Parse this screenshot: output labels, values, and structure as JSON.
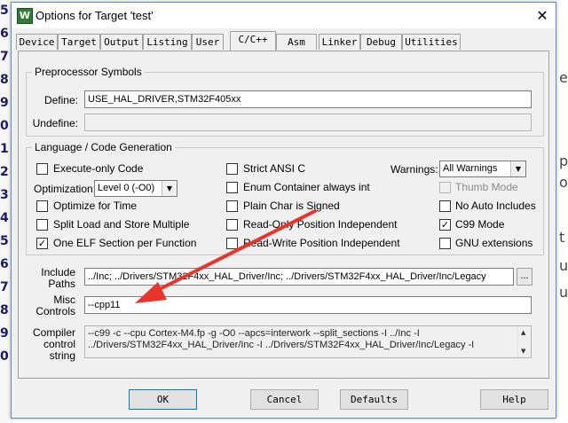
{
  "window": {
    "title": "Options for Target 'test'",
    "close_glyph": "✕",
    "app_icon_glyph": "W"
  },
  "tabs": [
    {
      "label": "Device"
    },
    {
      "label": "Target"
    },
    {
      "label": "Output"
    },
    {
      "label": "Listing"
    },
    {
      "label": "User"
    },
    {
      "label": "C/C++",
      "active": true
    },
    {
      "label": "Asm"
    },
    {
      "label": "Linker"
    },
    {
      "label": "Debug"
    },
    {
      "label": "Utilities"
    }
  ],
  "preprocessor": {
    "legend": "Preprocessor Symbols",
    "define_label": "Define:",
    "define_value": "USE_HAL_DRIVER,STM32F405xx",
    "undefine_label": "Undefine:",
    "undefine_value": ""
  },
  "language": {
    "legend": "Language / Code Generation",
    "execute_only": {
      "label": "Execute-only Code",
      "checked": false
    },
    "optimization_label": "Optimization:",
    "optimization_value": "Level 0 (-O0)",
    "optimize_time": {
      "label": "Optimize for Time",
      "checked": false
    },
    "split_load": {
      "label": "Split Load and Store Multiple",
      "checked": false
    },
    "one_elf": {
      "label": "One ELF Section per Function",
      "checked": true
    },
    "strict_ansi": {
      "label": "Strict ANSI C",
      "checked": false
    },
    "enum_container": {
      "label": "Enum Container always int",
      "checked": false
    },
    "plain_char": {
      "label": "Plain Char is Signed",
      "checked": false
    },
    "ropi": {
      "label": "Read-Only Position Independent",
      "checked": false
    },
    "rwpi": {
      "label": "Read-Write Position Independent",
      "checked": false
    },
    "warnings_label": "Warnings:",
    "warnings_value": "All Warnings",
    "thumb_mode": {
      "label": "Thumb Mode",
      "checked": false,
      "disabled": true
    },
    "no_auto_includes": {
      "label": "No Auto Includes",
      "checked": false
    },
    "c99_mode": {
      "label": "C99 Mode",
      "checked": true
    },
    "gnu_extensions": {
      "label": "GNU extensions",
      "checked": false
    }
  },
  "include_paths": {
    "label_line1": "Include",
    "label_line2": "Paths",
    "value": "../Inc;   ../Drivers/STM32F4xx_HAL_Driver/Inc;   ../Drivers/STM32F4xx_HAL_Driver/Inc/Legacy",
    "browse_label": "..."
  },
  "misc_controls": {
    "label_line1": "Misc",
    "label_line2": "Controls",
    "value": "--cpp11"
  },
  "compiler_control": {
    "label_line1": "Compiler",
    "label_line2": "control",
    "label_line3": "string",
    "line1": "--c99 -c --cpu Cortex-M4.fp -g -O0 --apcs=interwork --split_sections -I ../Inc -I",
    "line2": "../Drivers/STM32F4xx_HAL_Driver/Inc -I ../Drivers/STM32F4xx_HAL_Driver/Inc/Legacy -I"
  },
  "buttons": {
    "ok": "OK",
    "cancel": "Cancel",
    "defaults": "Defaults",
    "help": "Help"
  },
  "annotation": {
    "arrow_color": "#e8342b"
  },
  "background": {
    "left_chars": [
      "5",
      "6",
      "7",
      "8",
      "9",
      "0",
      "1",
      "2",
      "3",
      "4",
      "5",
      "6",
      "7",
      "8",
      "9",
      "0"
    ],
    "right_chars": [
      "e",
      "p",
      "o",
      "t",
      "u",
      "u"
    ]
  }
}
